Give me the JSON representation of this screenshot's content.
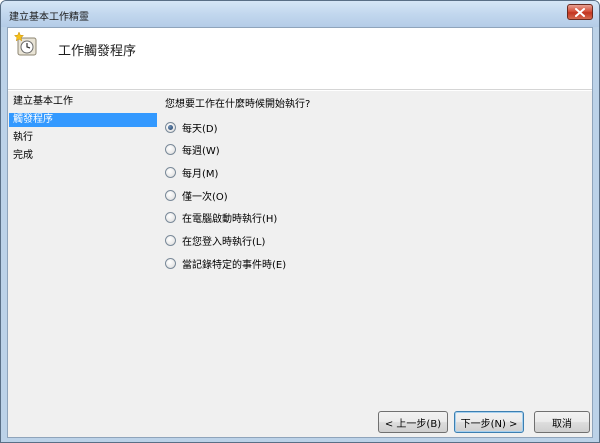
{
  "window": {
    "title": "建立基本工作精靈"
  },
  "header": {
    "title": "工作觸發程序",
    "icon": "clock-star-icon"
  },
  "steps": [
    {
      "label": "建立基本工作",
      "active": false
    },
    {
      "label": "觸發程序",
      "active": true
    },
    {
      "label": "執行",
      "active": false
    },
    {
      "label": "完成",
      "active": false
    }
  ],
  "content": {
    "question": "您想要工作在什麼時候開始執行?",
    "options": [
      {
        "label": "每天(D)",
        "selected": true
      },
      {
        "label": "每週(W)",
        "selected": false
      },
      {
        "label": "每月(M)",
        "selected": false
      },
      {
        "label": "僅一次(O)",
        "selected": false
      },
      {
        "label": "在電腦啟動時執行(H)",
        "selected": false
      },
      {
        "label": "在您登入時執行(L)",
        "selected": false
      },
      {
        "label": "當記錄特定的事件時(E)",
        "selected": false
      }
    ]
  },
  "buttons": {
    "back": "< 上一步(B)",
    "next": "下一步(N) >",
    "cancel": "取消"
  },
  "colors": {
    "selection": "#3399ff",
    "close": "#c3341f"
  }
}
